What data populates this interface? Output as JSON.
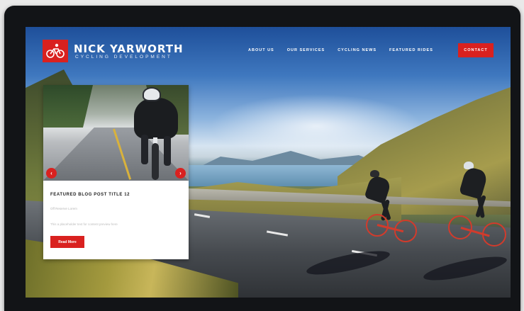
{
  "brand": {
    "name": "NICK YARWORTH",
    "tagline": "CYCLING DEVELOPMENT",
    "logo_icon": "cyclist-icon",
    "accent_color": "#d9211f"
  },
  "nav": {
    "items": [
      {
        "label": "ABOUT US"
      },
      {
        "label": "OUR SERVICES"
      },
      {
        "label": "CYCLING NEWS"
      },
      {
        "label": "FEATURED RIDES"
      }
    ],
    "contact_label": "CONTACT"
  },
  "card": {
    "title": "FEATURED BLOG POST TITLE 12",
    "meta": "Off Reserve Lorem",
    "excerpt": "This a placeholder text for content preview here",
    "read_more_label": "Read More",
    "prev_icon": "chevron-left-icon",
    "prev_glyph": "‹",
    "next_icon": "chevron-right-icon",
    "next_glyph": "›"
  }
}
